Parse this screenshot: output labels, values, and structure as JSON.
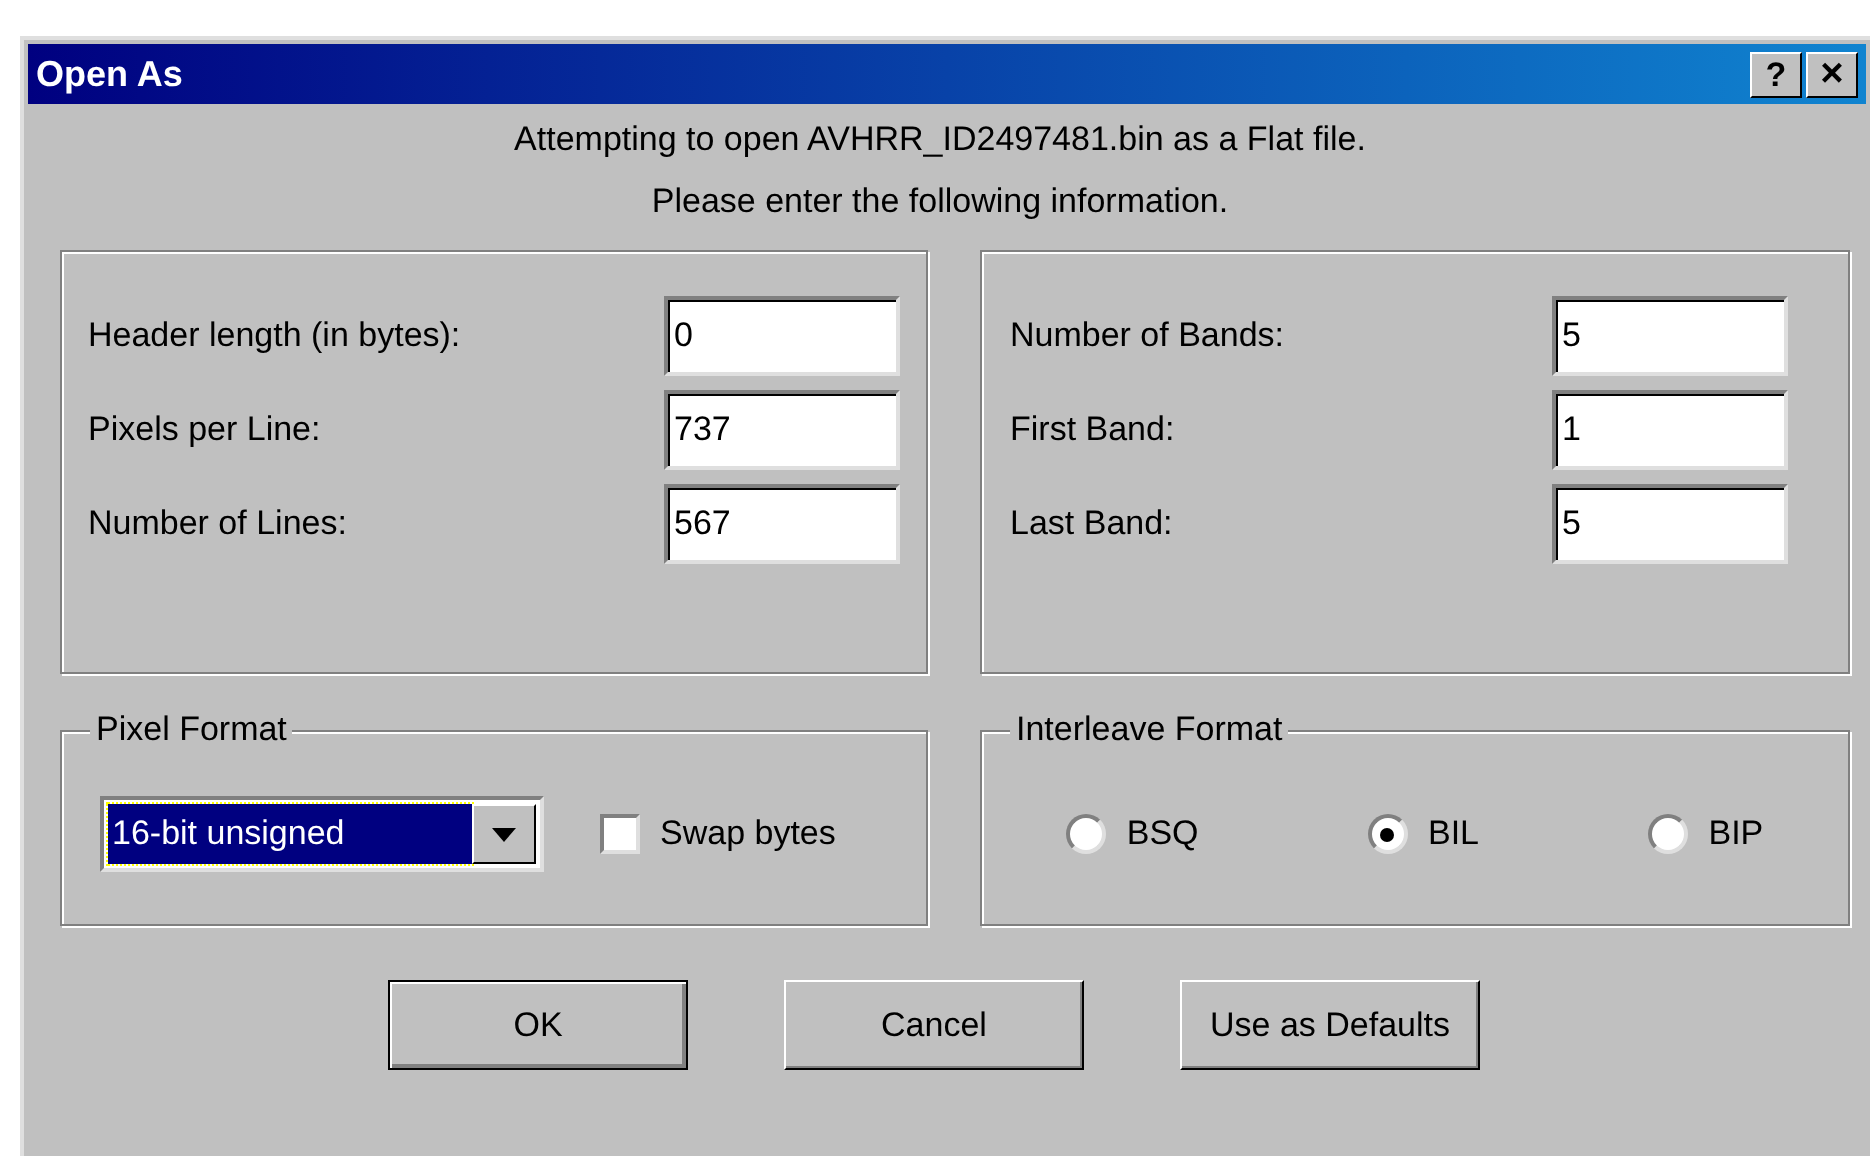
{
  "window": {
    "title": "Open As",
    "help_button": "?",
    "close_button": "×"
  },
  "message": [
    "Attempting to open AVHRR_ID2497481.bin as a Flat file.",
    "Please enter the following information."
  ],
  "size_fields": [
    {
      "label": "Header length (in bytes):",
      "value": "0"
    },
    {
      "label": "Pixels per Line:",
      "value": "737"
    },
    {
      "label": "Number of Lines:",
      "value": "567"
    }
  ],
  "band_fields": [
    {
      "label": "Number of Bands:",
      "value": "5"
    },
    {
      "label": "First Band:",
      "value": "1"
    },
    {
      "label": "Last Band:",
      "value": "5"
    }
  ],
  "pixel_format": {
    "title": "Pixel Format",
    "dropdown": {
      "value": "16-bit unsigned",
      "focused": true
    },
    "swap_bytes": {
      "label": "Swap bytes",
      "checked": false
    }
  },
  "interleave_format": {
    "title": "Interleave Format",
    "options": [
      {
        "label": "BSQ",
        "selected": false
      },
      {
        "label": "BIL",
        "selected": true
      },
      {
        "label": "BIP",
        "selected": false
      }
    ]
  },
  "buttons": [
    {
      "label": "OK",
      "default": true
    },
    {
      "label": "Cancel",
      "default": false
    },
    {
      "label": "Use as Defaults",
      "default": false
    }
  ]
}
